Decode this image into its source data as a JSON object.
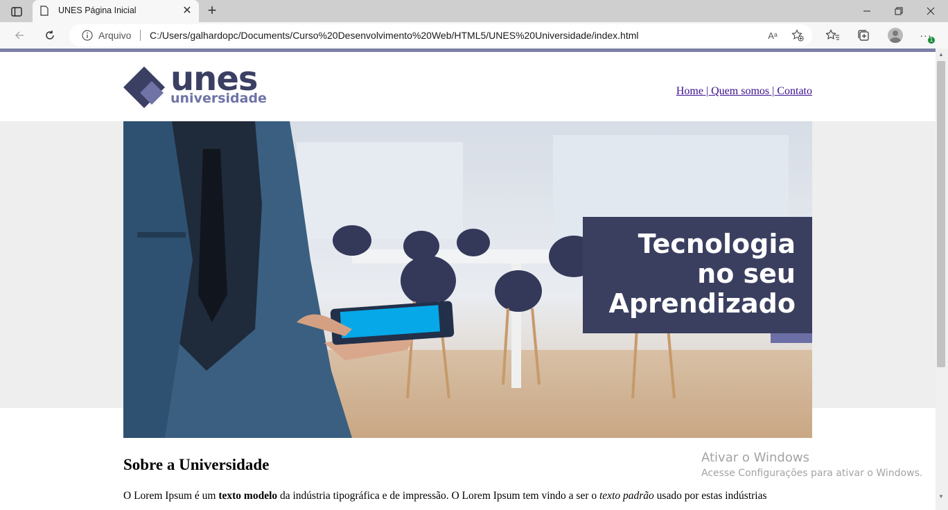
{
  "browser": {
    "tab_title": "UNES Página Inicial",
    "tab_close": "✕",
    "new_tab": "+",
    "address_scheme": "Arquivo",
    "address_url": "C:/Users/galhardopc/Documents/Curso%20Desenvolvimento%20Web/HTML5/UNES%20Universidade/index.html",
    "read_aloud_glyph": "Aᵃ",
    "badge": "1",
    "icons": [
      "sidebar-icon",
      "page-icon",
      "back-icon",
      "refresh-icon",
      "info-icon",
      "read-aloud-icon",
      "add-favorite-icon",
      "favorites-icon",
      "collections-icon",
      "profile-icon",
      "more-icon",
      "minimize-icon",
      "restore-icon",
      "close-icon"
    ]
  },
  "site": {
    "logo_word": "unes",
    "logo_sub": "universidade",
    "nav": [
      "Home",
      "Quem somos",
      "Contato"
    ],
    "nav_separator": " | ",
    "banner_text": [
      "Tecnologia",
      "no seu",
      "Aprendizado"
    ],
    "about_title": "Sobre a Universidade",
    "about_text": {
      "p1": "O Lorem Ipsum é um ",
      "b1": "texto modelo",
      "p2": " da indústria tipográfica e de impressão. O Lorem Ipsum tem vindo a ser o ",
      "i1": "texto padrão",
      "p3": " usado por estas indústrias"
    },
    "colors": {
      "brand_dark": "#3b3f63",
      "brand_light": "#6f73a6",
      "band": "#eeeeee"
    }
  },
  "watermark": {
    "line1": "Ativar o Windows",
    "line2": "Acesse Configurações para ativar o Windows."
  }
}
